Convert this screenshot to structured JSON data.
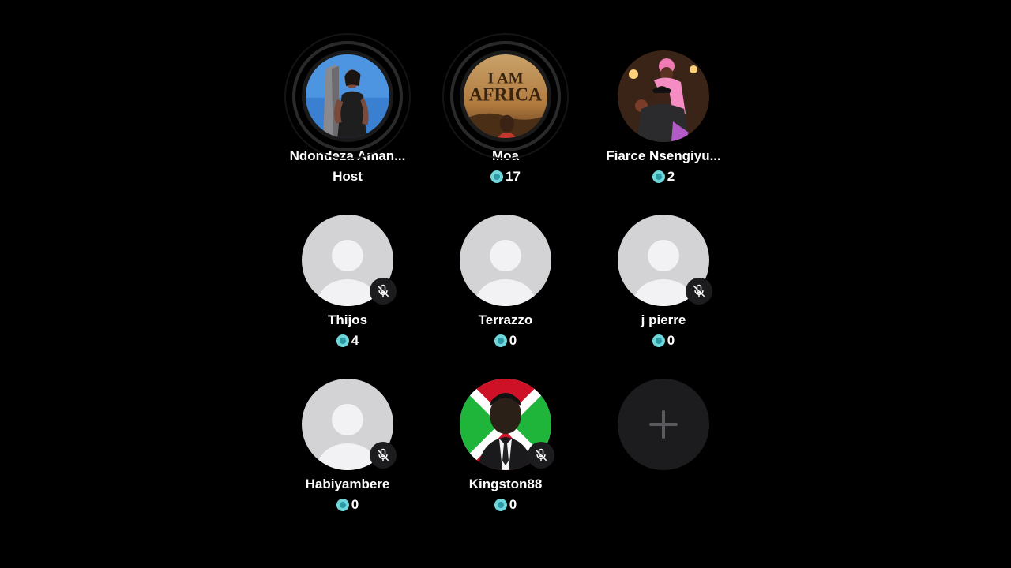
{
  "participants": [
    {
      "name": "Ndondeza Aman...",
      "sub": "Host",
      "muted": false,
      "avatar": "photo-woman-blue-sky",
      "speaking": true
    },
    {
      "name": "Moa",
      "count": "17",
      "muted": false,
      "avatar": "i-am-africa-poster",
      "speaking": true
    },
    {
      "name": "Fiarce Nsengiyu...",
      "count": "2",
      "muted": false,
      "avatar": "photo-couple-pink",
      "speaking": false
    },
    {
      "name": "Thijos",
      "count": "4",
      "muted": true,
      "avatar": "default-avatar"
    },
    {
      "name": "Terrazzo",
      "count": "0",
      "muted": false,
      "avatar": "default-avatar"
    },
    {
      "name": "j pierre",
      "count": "0",
      "muted": true,
      "avatar": "default-avatar"
    },
    {
      "name": "Habiyambere",
      "count": "0",
      "muted": true,
      "avatar": "default-avatar"
    },
    {
      "name": "Kingston88",
      "count": "0",
      "muted": true,
      "avatar": "photo-man-flag"
    }
  ],
  "poster_text": {
    "line1": "I AM",
    "line2": "AFRICA"
  },
  "colors": {
    "background": "#000000",
    "coin": "#6fd6dc",
    "placeholder": "#d3d3d6",
    "badge": "#1c1c1e"
  },
  "add_slot_icon": "plus-icon",
  "coin_icon": "coin-icon",
  "mute_icon": "mic-off-icon"
}
